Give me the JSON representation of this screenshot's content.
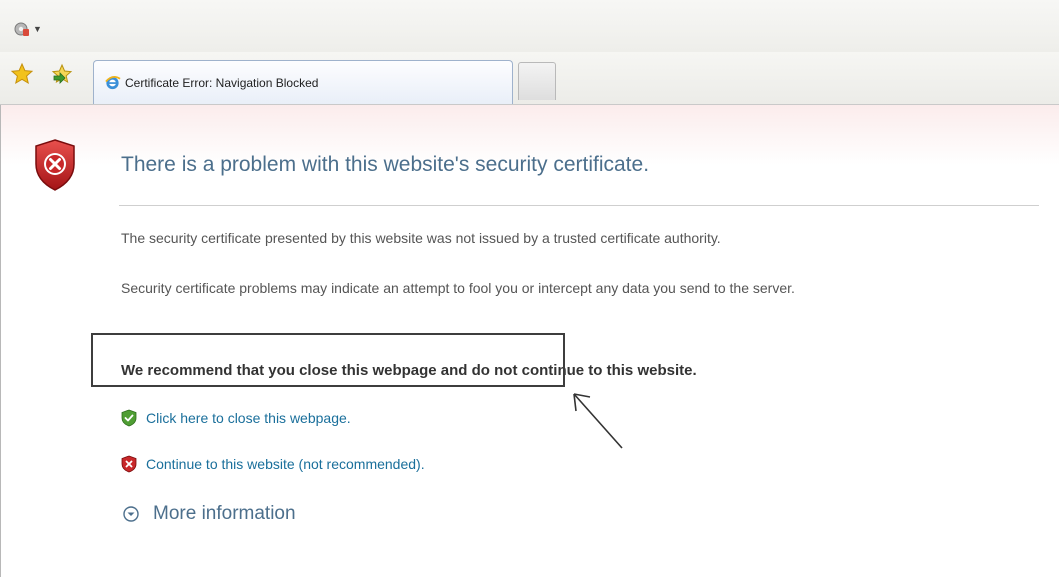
{
  "tab": {
    "title": "Certificate Error: Navigation Blocked",
    "icon": "ie-icon"
  },
  "toolbar": {
    "tools_icon": "tools-menu-icon",
    "favorites_icon": "favorites-star-icon",
    "add_favorites_icon": "add-favorites-icon"
  },
  "page": {
    "heading": "There is a problem with this website's security certificate.",
    "para1": "The security certificate presented by this website was not issued by a trusted certificate authority.",
    "para2": "Security certificate problems may indicate an attempt to fool you or intercept any data you send to the server.",
    "recommend": "We recommend that you close this webpage and do not continue to this website.",
    "close_link": "Click here to close this webpage.",
    "continue_link": "Continue to this website (not recommended).",
    "more_info": "More information"
  },
  "colors": {
    "heading": "#4c6f8c",
    "link": "#1a6f9b",
    "shield_red": "#c8282a",
    "green_shield": "#4f9e33"
  }
}
